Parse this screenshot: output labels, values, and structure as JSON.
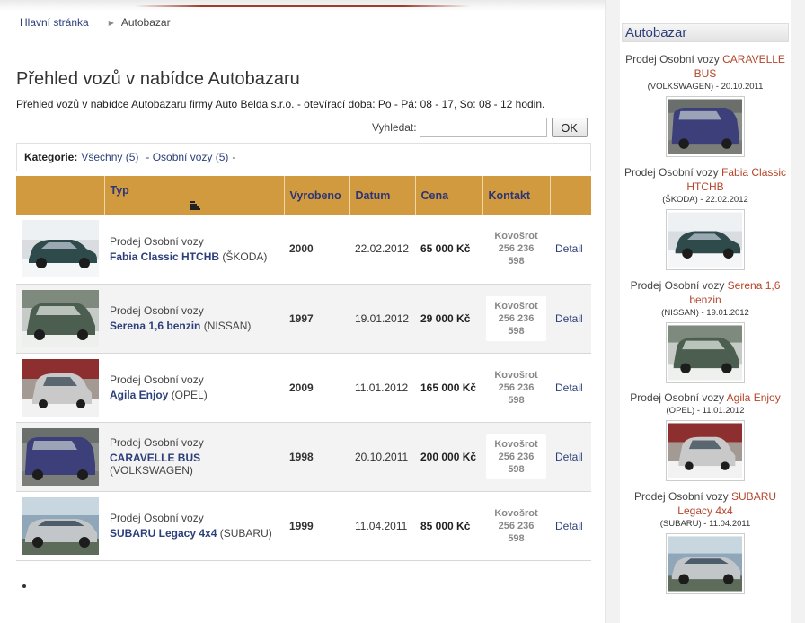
{
  "breadcrumb": {
    "home": "Hlavní stránka",
    "current": "Autobazar"
  },
  "page": {
    "title": "Přehled vozů v nabídce Autobazaru",
    "intro": "Přehled vozů v nabídce Autobazaru firmy Auto Belda s.r.o. - otevírací doba: Po - Pá: 08 - 17, So: 08 - 12 hodin."
  },
  "search": {
    "label": "Vyhledat:",
    "value": "",
    "button": "OK"
  },
  "category": {
    "label": "Kategorie:",
    "all": "Všechny (5)",
    "personal": "- Osobní vozy (5)",
    "dash": "-"
  },
  "table": {
    "headers": {
      "typ": "Typ",
      "year": "Vyrobeno",
      "date": "Datum",
      "price": "Cena",
      "contact": "Kontakt"
    },
    "rows": [
      {
        "type_prefix": "Prodej Osobní vozy",
        "name": "Fabia Classic HTCHB",
        "brand": "(ŠKODA)",
        "year": "2000",
        "date": "22.02.2012",
        "price": "65 000 Kč",
        "contact_name": "Kovošrot",
        "contact_phone": "256 236 598",
        "detail": "Detail"
      },
      {
        "type_prefix": "Prodej Osobní vozy",
        "name": "Serena 1,6 benzin",
        "brand": "(NISSAN)",
        "year": "1997",
        "date": "19.01.2012",
        "price": "29 000 Kč",
        "contact_name": "Kovošrot",
        "contact_phone": "256 236 598",
        "detail": "Detail"
      },
      {
        "type_prefix": "Prodej Osobní vozy",
        "name": "Agila Enjoy",
        "brand": "(OPEL)",
        "year": "2009",
        "date": "11.01.2012",
        "price": "165 000 Kč",
        "contact_name": "Kovošrot",
        "contact_phone": "256 236 598",
        "detail": "Detail"
      },
      {
        "type_prefix": "Prodej Osobní vozy",
        "name": "CARAVELLE BUS",
        "brand": "(VOLKSWAGEN)",
        "year": "1998",
        "date": "20.10.2011",
        "price": "200 000 Kč",
        "contact_name": "Kovošrot",
        "contact_phone": "256 236 598",
        "detail": "Detail"
      },
      {
        "type_prefix": "Prodej Osobní vozy",
        "name": "SUBARU Legacy 4x4",
        "brand": "(SUBARU)",
        "year": "1999",
        "date": "11.04.2011",
        "price": "85 000 Kč",
        "contact_name": "Kovošrot",
        "contact_phone": "256 236 598",
        "detail": "Detail"
      }
    ]
  },
  "sidebar": {
    "title": "Autobazar",
    "items": [
      {
        "prefix": "Prodej Osobní vozy",
        "name": "CARAVELLE BUS",
        "meta": "(VOLKSWAGEN) - 20.10.2011"
      },
      {
        "prefix": "Prodej Osobní vozy",
        "name": "Fabia Classic HTCHB",
        "meta": "(ŠKODA) - 22.02.2012"
      },
      {
        "prefix": "Prodej Osobní vozy",
        "name": "Serena 1,6 benzin",
        "meta": "(NISSAN) - 19.01.2012"
      },
      {
        "prefix": "Prodej Osobní vozy",
        "name": "Agila Enjoy",
        "meta": "(OPEL) - 11.01.2012"
      },
      {
        "prefix": "Prodej Osobní vozy",
        "name": "SUBARU Legacy 4x4",
        "meta": "(SUBARU) - 11.04.2011"
      }
    ]
  },
  "colors": {
    "header_bg": "#d29a3f",
    "link": "#2c3f7a",
    "accent": "#b5452b"
  }
}
